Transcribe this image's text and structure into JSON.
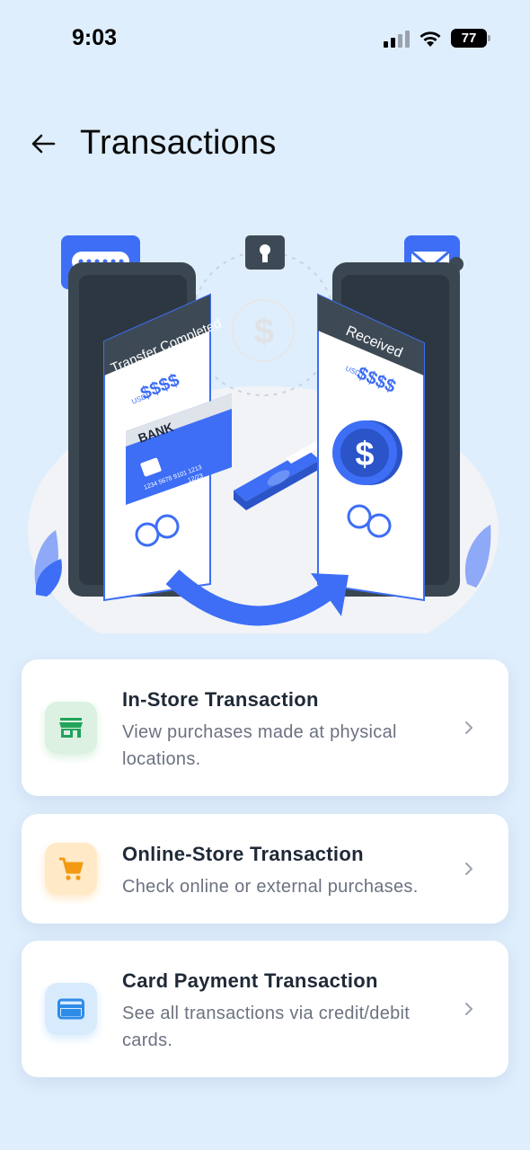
{
  "status_bar": {
    "time": "9:03",
    "battery": "77",
    "icons": [
      "signal-icon",
      "wifi-icon",
      "battery-icon"
    ]
  },
  "header": {
    "title": "Transactions",
    "back_icon": "arrow-left-icon"
  },
  "illustration": {
    "left_phone_heading": "Transfer Completed",
    "left_phone_amount": "$$$$",
    "left_phone_currency": "USD",
    "card_brand": "BANK",
    "card_number": "1234 5678 9101 1213",
    "card_expiry": "12/23",
    "right_phone_heading": "Received",
    "right_phone_amount": "$$$$",
    "right_phone_currency": "USD",
    "coin_symbol": "$",
    "accent_color": "#3d6ef5"
  },
  "options": [
    {
      "title": "In-Store Transaction",
      "description": "View purchases made at physical locations.",
      "icon": "store-icon",
      "icon_bg": "#dcf1e2",
      "icon_color": "#22a35a"
    },
    {
      "title": "Online-Store Transaction",
      "description": "Check online or external purchases.",
      "icon": "cart-icon",
      "icon_bg": "#ffe9c7",
      "icon_color": "#f39a12"
    },
    {
      "title": "Card Payment Transaction",
      "description": "See all transactions via credit/debit cards.",
      "icon": "credit-card-icon",
      "icon_bg": "#d7ebfd",
      "icon_color": "#2f8be8"
    }
  ]
}
